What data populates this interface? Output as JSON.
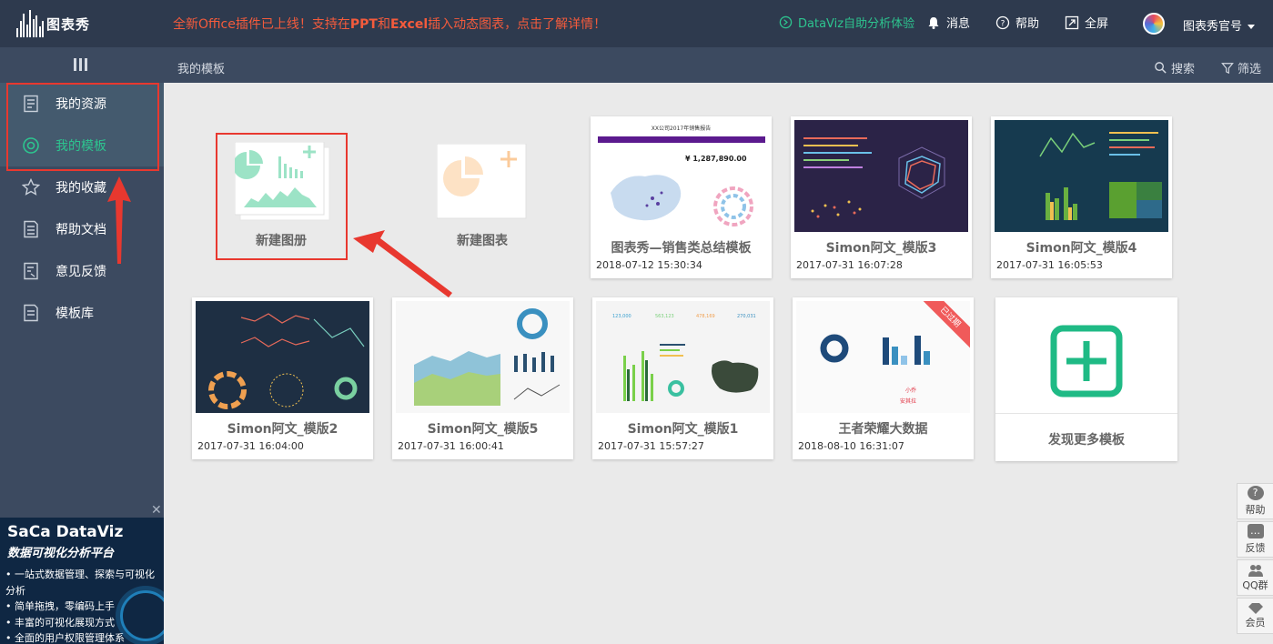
{
  "header": {
    "logo_text": "图表秀",
    "announcement": {
      "part1": "全新Office插件已上线！支持在",
      "ppt": "PPT",
      "part2": "和",
      "excel": "Excel",
      "part3": "插入动态图表，点击了解详情！"
    },
    "dataviz_link": "DataViz自助分析体验",
    "messages": "消息",
    "help": "帮助",
    "fullscreen": "全屏",
    "username": "图表秀官号"
  },
  "subbar": {
    "breadcrumb": "我的模板",
    "search": "搜索",
    "filter": "筛选"
  },
  "sidebar": {
    "items": [
      {
        "label": "我的资源"
      },
      {
        "label": "我的模板"
      },
      {
        "label": "我的收藏"
      },
      {
        "label": "帮助文档"
      },
      {
        "label": "意见反馈"
      },
      {
        "label": "模板库"
      }
    ]
  },
  "promo": {
    "title": "SaCa DataViz",
    "subtitle": "数据可视化分析平台",
    "bullets": [
      "• 一站式数据管理、探索与可视化分析",
      "• 简单拖拽，零编码上手",
      "• 丰富的可视化展现方式",
      "• 全面的用户权限管理体系"
    ],
    "close": "✕"
  },
  "main": {
    "new_album": "新建图册",
    "new_chart": "新建图表",
    "templates": [
      {
        "title": "图表秀—销售类总结模板",
        "date": "2018-07-12 15:30:34",
        "thumb_title": "XX公司2017年销售报告",
        "thumb_value": "¥ 1,287,890.00"
      },
      {
        "title": "Simon阿文_模版3",
        "date": "2017-07-31 16:07:28"
      },
      {
        "title": "Simon阿文_模版4",
        "date": "2017-07-31 16:05:53"
      },
      {
        "title": "Simon阿文_模版2",
        "date": "2017-07-31 16:04:00"
      },
      {
        "title": "Simon阿文_模版5",
        "date": "2017-07-31 16:00:41"
      },
      {
        "title": "Simon阿文_模版1",
        "date": "2017-07-31 15:57:27"
      },
      {
        "title": "王者荣耀大数据",
        "date": "2018-08-10 16:31:07",
        "ribbon": "已过期"
      }
    ],
    "discover_more": "发现更多模板"
  },
  "float_bar": {
    "help": "帮助",
    "feedback": "反馈",
    "qq": "QQ群",
    "member": "会员"
  },
  "colors": {
    "accent_green": "#2dc48f",
    "announce_red": "#f45b3c",
    "annotation_red": "#e8382f",
    "topbar_bg": "#2e3a4e",
    "sidebar_bg": "#3c4a60"
  }
}
